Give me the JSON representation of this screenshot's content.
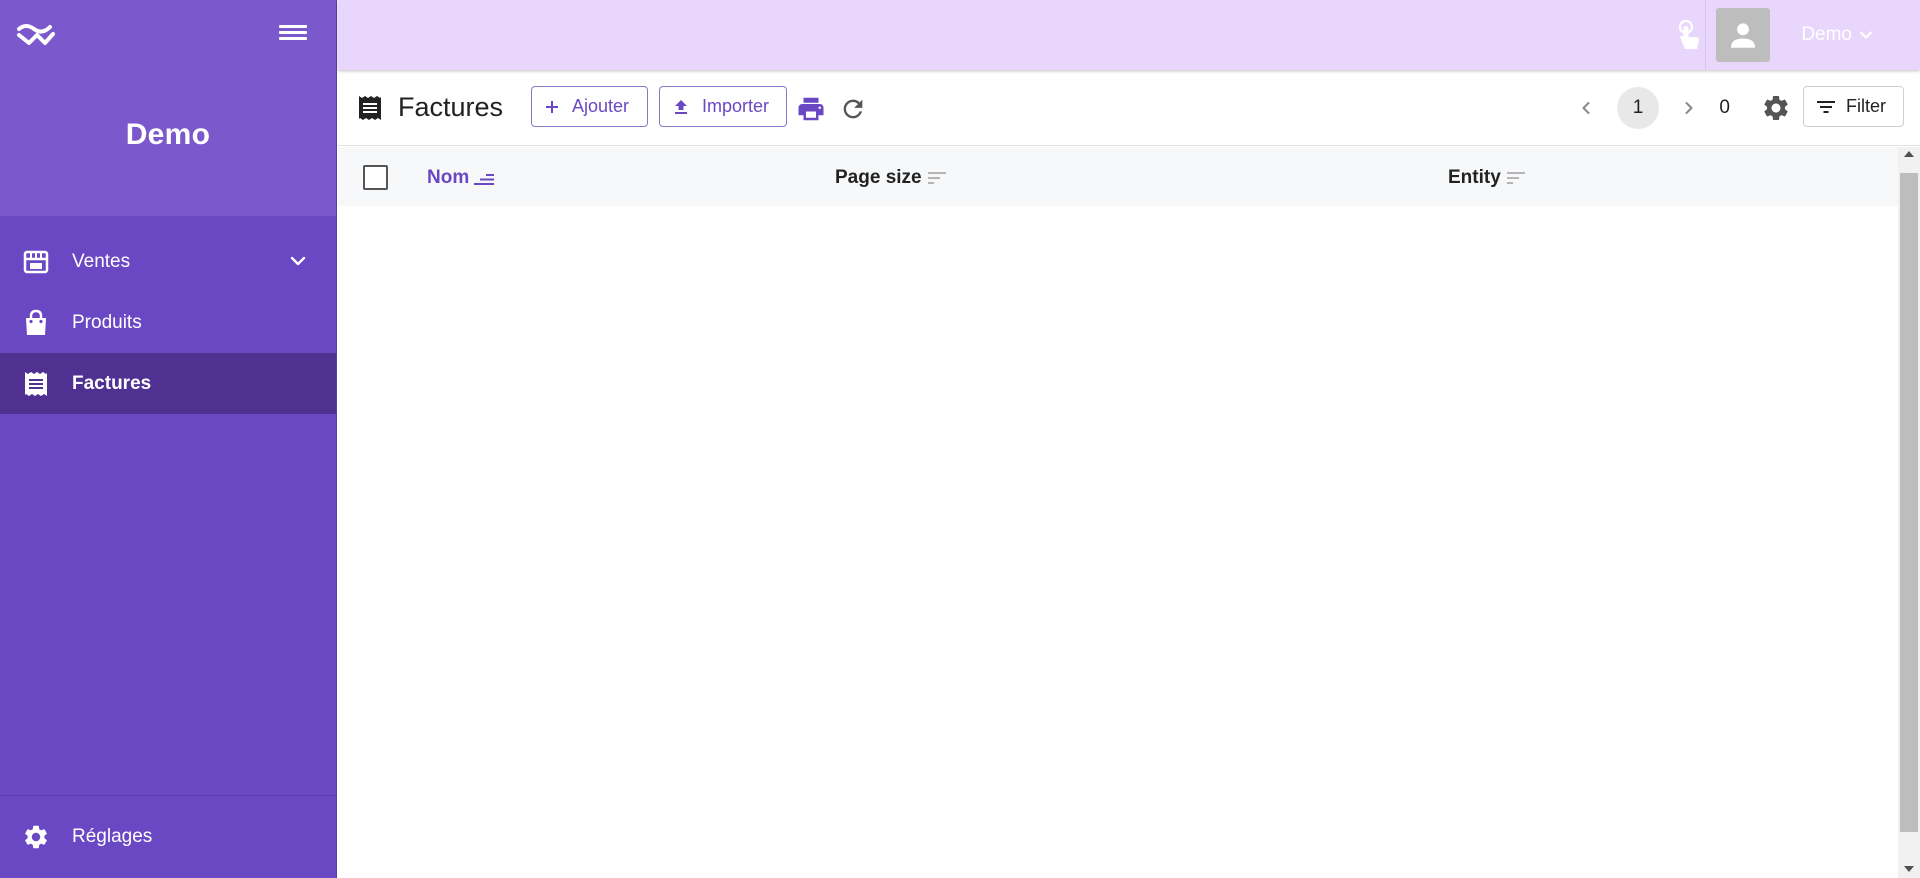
{
  "sidebar": {
    "brand": "Demo",
    "items": [
      {
        "label": "Ventes",
        "icon": "store-icon"
      },
      {
        "label": "Produits",
        "icon": "shopping-bag-icon"
      },
      {
        "label": "Factures",
        "icon": "receipt-icon",
        "active": true
      }
    ],
    "settings_label": "Réglages"
  },
  "topbar": {
    "user_name": "Demo"
  },
  "toolbar": {
    "title": "Factures",
    "add_label": "Ajouter",
    "import_label": "Importer",
    "filter_label": "Filter"
  },
  "pager": {
    "current_page": "1",
    "total": "0"
  },
  "table": {
    "columns": [
      "Nom",
      "Page size",
      "Entity"
    ]
  },
  "colors": {
    "sidebar": "#6a48c3",
    "sidebar_header": "#7b59cc",
    "sidebar_active": "#4e3191",
    "topbar": "#e9d6fd",
    "accent": "#6a48c3"
  }
}
